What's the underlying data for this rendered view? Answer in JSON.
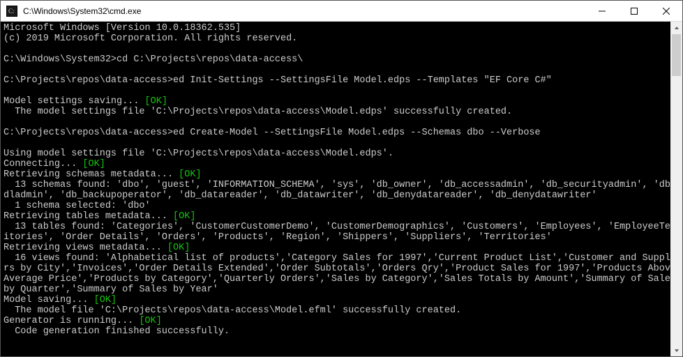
{
  "titlebar": {
    "title": "C:\\Windows\\System32\\cmd.exe"
  },
  "lines": [
    {
      "t": "plain",
      "text": "Microsoft Windows [Version 10.0.18362.535]"
    },
    {
      "t": "plain",
      "text": "(c) 2019 Microsoft Corporation. All rights reserved."
    },
    {
      "t": "blank"
    },
    {
      "t": "plain",
      "text": "C:\\Windows\\System32>cd C:\\Projects\\repos\\data-access\\"
    },
    {
      "t": "blank"
    },
    {
      "t": "plain",
      "text": "C:\\Projects\\repos\\data-access>ed Init-Settings --SettingsFile Model.edps --Templates \"EF Core C#\""
    },
    {
      "t": "blank"
    },
    {
      "t": "ok",
      "pre": "Model settings saving... ",
      "ok": "[OK]"
    },
    {
      "t": "plain",
      "text": "  The model settings file 'C:\\Projects\\repos\\data-access\\Model.edps' successfully created."
    },
    {
      "t": "blank"
    },
    {
      "t": "plain",
      "text": "C:\\Projects\\repos\\data-access>ed Create-Model --SettingsFile Model.edps --Schemas dbo --Verbose"
    },
    {
      "t": "blank"
    },
    {
      "t": "plain",
      "text": "Using model settings file 'C:\\Projects\\repos\\data-access\\Model.edps'."
    },
    {
      "t": "ok",
      "pre": "Connecting... ",
      "ok": "[OK]"
    },
    {
      "t": "ok",
      "pre": "Retrieving schemas metadata... ",
      "ok": "[OK]"
    },
    {
      "t": "plain",
      "text": "  13 schemas found: 'dbo', 'guest', 'INFORMATION_SCHEMA', 'sys', 'db_owner', 'db_accessadmin', 'db_securityadmin', 'db_d"
    },
    {
      "t": "plain",
      "text": "dladmin', 'db_backupoperator', 'db_datareader', 'db_datawriter', 'db_denydatareader', 'db_denydatawriter'"
    },
    {
      "t": "plain",
      "text": "  1 schema selected: 'dbo'"
    },
    {
      "t": "ok",
      "pre": "Retrieving tables metadata... ",
      "ok": "[OK]"
    },
    {
      "t": "plain",
      "text": "  13 tables found: 'Categories', 'CustomerCustomerDemo', 'CustomerDemographics', 'Customers', 'Employees', 'EmployeeTerr"
    },
    {
      "t": "plain",
      "text": "itories', 'Order Details', 'Orders', 'Products', 'Region', 'Shippers', 'Suppliers', 'Territories'"
    },
    {
      "t": "ok",
      "pre": "Retrieving views metadata... ",
      "ok": "[OK]"
    },
    {
      "t": "plain",
      "text": "  16 views found: 'Alphabetical list of products','Category Sales for 1997','Current Product List','Customer and Supplie"
    },
    {
      "t": "plain",
      "text": "rs by City','Invoices','Order Details Extended','Order Subtotals','Orders Qry','Product Sales for 1997','Products Above "
    },
    {
      "t": "plain",
      "text": "Average Price','Products by Category','Quarterly Orders','Sales by Category','Sales Totals by Amount','Summary of Sales "
    },
    {
      "t": "plain",
      "text": "by Quarter','Summary of Sales by Year'"
    },
    {
      "t": "ok",
      "pre": "Model saving... ",
      "ok": "[OK]"
    },
    {
      "t": "plain",
      "text": "  The model file 'C:\\Projects\\repos\\data-access\\Model.efml' successfully created."
    },
    {
      "t": "ok",
      "pre": "Generator is running... ",
      "ok": "[OK]"
    },
    {
      "t": "plain",
      "text": "  Code generation finished successfully."
    }
  ]
}
